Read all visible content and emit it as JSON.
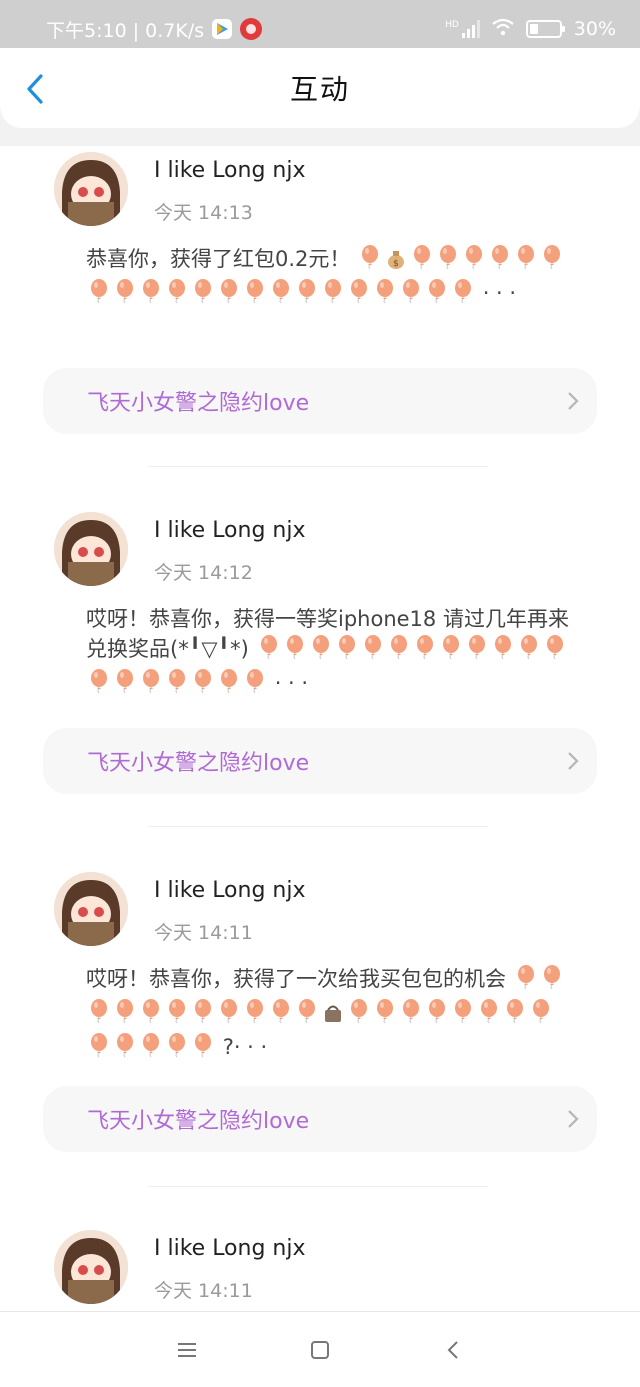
{
  "status_bar": {
    "time_speed": "下午5:10 | 0.7K/s",
    "battery": "30%",
    "hd_label": "HD"
  },
  "header": {
    "title": "互动",
    "back_icon": "chevron-left-icon"
  },
  "colors": {
    "accent": "#1d8fe0",
    "link": "#b06ad6",
    "balloon": "#f4a07c"
  },
  "items": [
    {
      "username": "I like Long njx",
      "time": "今天 14:13",
      "message_text": "恭喜你，获得了红包0.2元！",
      "message_tail": "· · ·",
      "link": "飞天小女警之隐约love"
    },
    {
      "username": "I like Long njx",
      "time": "今天 14:12",
      "message_text": "哎呀！恭喜你，获得一等奖iphone18 请过几年再来兑换奖品(*╹▽╹*)",
      "message_tail": "· · ·",
      "link": "飞天小女警之隐约love"
    },
    {
      "username": "I like Long njx",
      "time": "今天 14:11",
      "message_text": "哎呀！恭喜你，获得了一次给我买包包的机会",
      "message_tail": "?· · ·",
      "link": "飞天小女警之隐约love"
    },
    {
      "username": "I like Long njx",
      "time": "今天 14:11"
    }
  ],
  "nav": {
    "menu_icon": "menu-icon",
    "home_icon": "home-square-icon",
    "back_icon": "back-chevron-icon"
  }
}
